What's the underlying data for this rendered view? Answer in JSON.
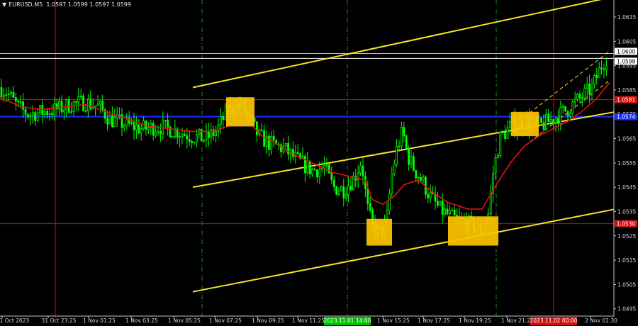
{
  "header": {
    "symbol": "EURUSD,M5",
    "ohlc": "1.0597 1.0599 1.0597 1.0599",
    "triangle_icon": "▼"
  },
  "colors": {
    "background": "#000000",
    "candles": "#00ff00",
    "ma": "#e8101a",
    "channel": "#f5e521",
    "level_red": "#c81010",
    "level_blue": "#1a2cff",
    "level_gray": "#b8b8c8",
    "box": "#ffc400",
    "vline_red": "#c81010",
    "vline_green": "#1f8f1f",
    "grid_axis": "#c8c8c8"
  },
  "chart_data": {
    "type": "candlestick",
    "symbol": "EURUSD",
    "timeframe": "M5",
    "ylim": [
      1.0492,
      1.0622
    ],
    "y_ticks": [
      "1.0615",
      "1.0605",
      "1.0595",
      "1.0585",
      "1.0575",
      "1.0565",
      "1.0555",
      "1.0545",
      "1.0535",
      "1.0525",
      "1.0515",
      "1.0505",
      "1.0495"
    ],
    "x_ticks": [
      "31 Oct 2023",
      "31 Oct 23:25",
      "1 Nov 01:25",
      "1 Nov 03:25",
      "1 Nov 05:25",
      "1 Nov 07:25",
      "1 Nov 09:25",
      "1 Nov 11:25",
      "1 Nov 15:25",
      "1 Nov 17:25",
      "1 Nov 19:25",
      "1 Nov 21:25",
      "2 Nov 01:30"
    ],
    "x_tick_highlights": [
      {
        "label": "2023.11.01 14:00",
        "color": "#00c000",
        "between": [
          7,
          8
        ]
      },
      {
        "label": "2023.11.02 00:00",
        "color": "#d01010",
        "between": [
          11,
          12
        ]
      }
    ],
    "levels": [
      {
        "value": 1.06,
        "label": "1.0600",
        "color": "#b8b8c8",
        "tag_color": "#ffffff",
        "tag_text": "#000000"
      },
      {
        "value": 1.0598,
        "label": "1.0598",
        "color": "#ffffff",
        "tag_color": "#ffffff",
        "tag_text": "#000000"
      },
      {
        "value": 1.0581,
        "label": "1.0581",
        "color": "#c81010",
        "tag_color": "#d01010",
        "tag_text": "#ffffff"
      },
      {
        "value": 1.0574,
        "label": "1.0574",
        "color": "#1a2cff",
        "tag_color": "#1a2cff",
        "tag_text": "#ffffff"
      },
      {
        "value": 1.053,
        "label": "1.0530",
        "color": "#c81010",
        "tag_color": "#d01010",
        "tag_text": "#ffffff"
      }
    ],
    "path": [
      [
        0,
        1.0586
      ],
      [
        10,
        1.0584
      ],
      [
        25,
        1.0578
      ],
      [
        40,
        1.0575
      ],
      [
        60,
        1.0576
      ],
      [
        80,
        1.0577
      ],
      [
        100,
        1.0579
      ],
      [
        120,
        1.058
      ],
      [
        140,
        1.0578
      ],
      [
        155,
        1.0573
      ],
      [
        175,
        1.0571
      ],
      [
        200,
        1.0569
      ],
      [
        225,
        1.057
      ],
      [
        250,
        1.0568
      ],
      [
        270,
        1.0566
      ],
      [
        290,
        1.0565
      ],
      [
        305,
        1.0568
      ],
      [
        320,
        1.0576
      ],
      [
        340,
        1.0579
      ],
      [
        355,
        1.0571
      ],
      [
        365,
        1.0566
      ],
      [
        380,
        1.0563
      ],
      [
        400,
        1.0561
      ],
      [
        420,
        1.0556
      ],
      [
        440,
        1.0552
      ],
      [
        458,
        1.0553
      ],
      [
        470,
        1.0545
      ],
      [
        485,
        1.0544
      ],
      [
        500,
        1.0549
      ],
      [
        510,
        1.0556
      ],
      [
        518,
        1.0537
      ],
      [
        525,
        1.0529
      ],
      [
        535,
        1.0526
      ],
      [
        545,
        1.053
      ],
      [
        552,
        1.0549
      ],
      [
        560,
        1.0561
      ],
      [
        568,
        1.0568
      ],
      [
        575,
        1.0558
      ],
      [
        585,
        1.0552
      ],
      [
        595,
        1.0548
      ],
      [
        605,
        1.0542
      ],
      [
        620,
        1.0536
      ],
      [
        640,
        1.0532
      ],
      [
        660,
        1.053
      ],
      [
        680,
        1.0527
      ],
      [
        690,
        1.0535
      ],
      [
        695,
        1.055
      ],
      [
        705,
        1.0565
      ],
      [
        720,
        1.057
      ],
      [
        740,
        1.0572
      ],
      [
        760,
        1.057
      ],
      [
        780,
        1.0573
      ],
      [
        800,
        1.0577
      ],
      [
        820,
        1.0582
      ],
      [
        835,
        1.0586
      ],
      [
        850,
        1.0596
      ],
      [
        858,
        1.0599
      ]
    ],
    "ma_path": [
      [
        0,
        1.0582
      ],
      [
        30,
        1.0578
      ],
      [
        60,
        1.0577
      ],
      [
        90,
        1.0578
      ],
      [
        120,
        1.0579
      ],
      [
        150,
        1.0576
      ],
      [
        180,
        1.0573
      ],
      [
        210,
        1.057
      ],
      [
        240,
        1.0569
      ],
      [
        270,
        1.0568
      ],
      [
        300,
        1.0568
      ],
      [
        330,
        1.0571
      ],
      [
        350,
        1.0572
      ],
      [
        370,
        1.0566
      ],
      [
        390,
        1.0563
      ],
      [
        410,
        1.0559
      ],
      [
        440,
        1.0555
      ],
      [
        470,
        1.0551
      ],
      [
        500,
        1.0549
      ],
      [
        515,
        1.0548
      ],
      [
        525,
        1.054
      ],
      [
        540,
        1.0538
      ],
      [
        555,
        1.0541
      ],
      [
        570,
        1.0546
      ],
      [
        590,
        1.0548
      ],
      [
        610,
        1.0543
      ],
      [
        630,
        1.0539
      ],
      [
        660,
        1.0536
      ],
      [
        680,
        1.0536
      ],
      [
        700,
        1.0546
      ],
      [
        720,
        1.0555
      ],
      [
        740,
        1.0562
      ],
      [
        760,
        1.0566
      ],
      [
        780,
        1.0569
      ],
      [
        800,
        1.0572
      ],
      [
        820,
        1.0576
      ],
      [
        840,
        1.0581
      ],
      [
        860,
        1.0588
      ]
    ],
    "channels": [
      {
        "from": [
          272,
          1.0586
        ],
        "to": [
          860,
          1.0623
        ]
      },
      {
        "from": [
          272,
          1.0545
        ],
        "to": [
          868,
          1.0576
        ]
      },
      {
        "from": [
          272,
          1.0502
        ],
        "to": [
          868,
          1.0536
        ]
      }
    ],
    "dashed_channels": [
      {
        "from": [
          740,
          1.0574
        ],
        "to": [
          860,
          1.0601
        ]
      },
      {
        "from": [
          740,
          1.0562
        ],
        "to": [
          860,
          1.0589
        ]
      }
    ],
    "boxes": [
      {
        "x0": 319,
        "x1": 359,
        "y_top": 1.0582,
        "y_bottom": 1.057
      },
      {
        "x0": 517,
        "x1": 553,
        "y_top": 1.0532,
        "y_bottom": 1.0521
      },
      {
        "x0": 632,
        "x1": 703,
        "y_top": 1.0533,
        "y_bottom": 1.0521
      },
      {
        "x0": 721,
        "x1": 760,
        "y_top": 1.0576,
        "y_bottom": 1.0566
      }
    ],
    "vlines": [
      {
        "x": 78,
        "color": "#c81010",
        "style": "solid"
      },
      {
        "x": 285,
        "color": "#1f8f1f",
        "style": "dashdot"
      },
      {
        "x": 490,
        "color": "#1f8f1f",
        "style": "dashdot"
      },
      {
        "x": 700,
        "color": "#1f8f1f",
        "style": "dashdot"
      },
      {
        "x": 781,
        "color": "#c81010",
        "style": "solid"
      }
    ]
  }
}
